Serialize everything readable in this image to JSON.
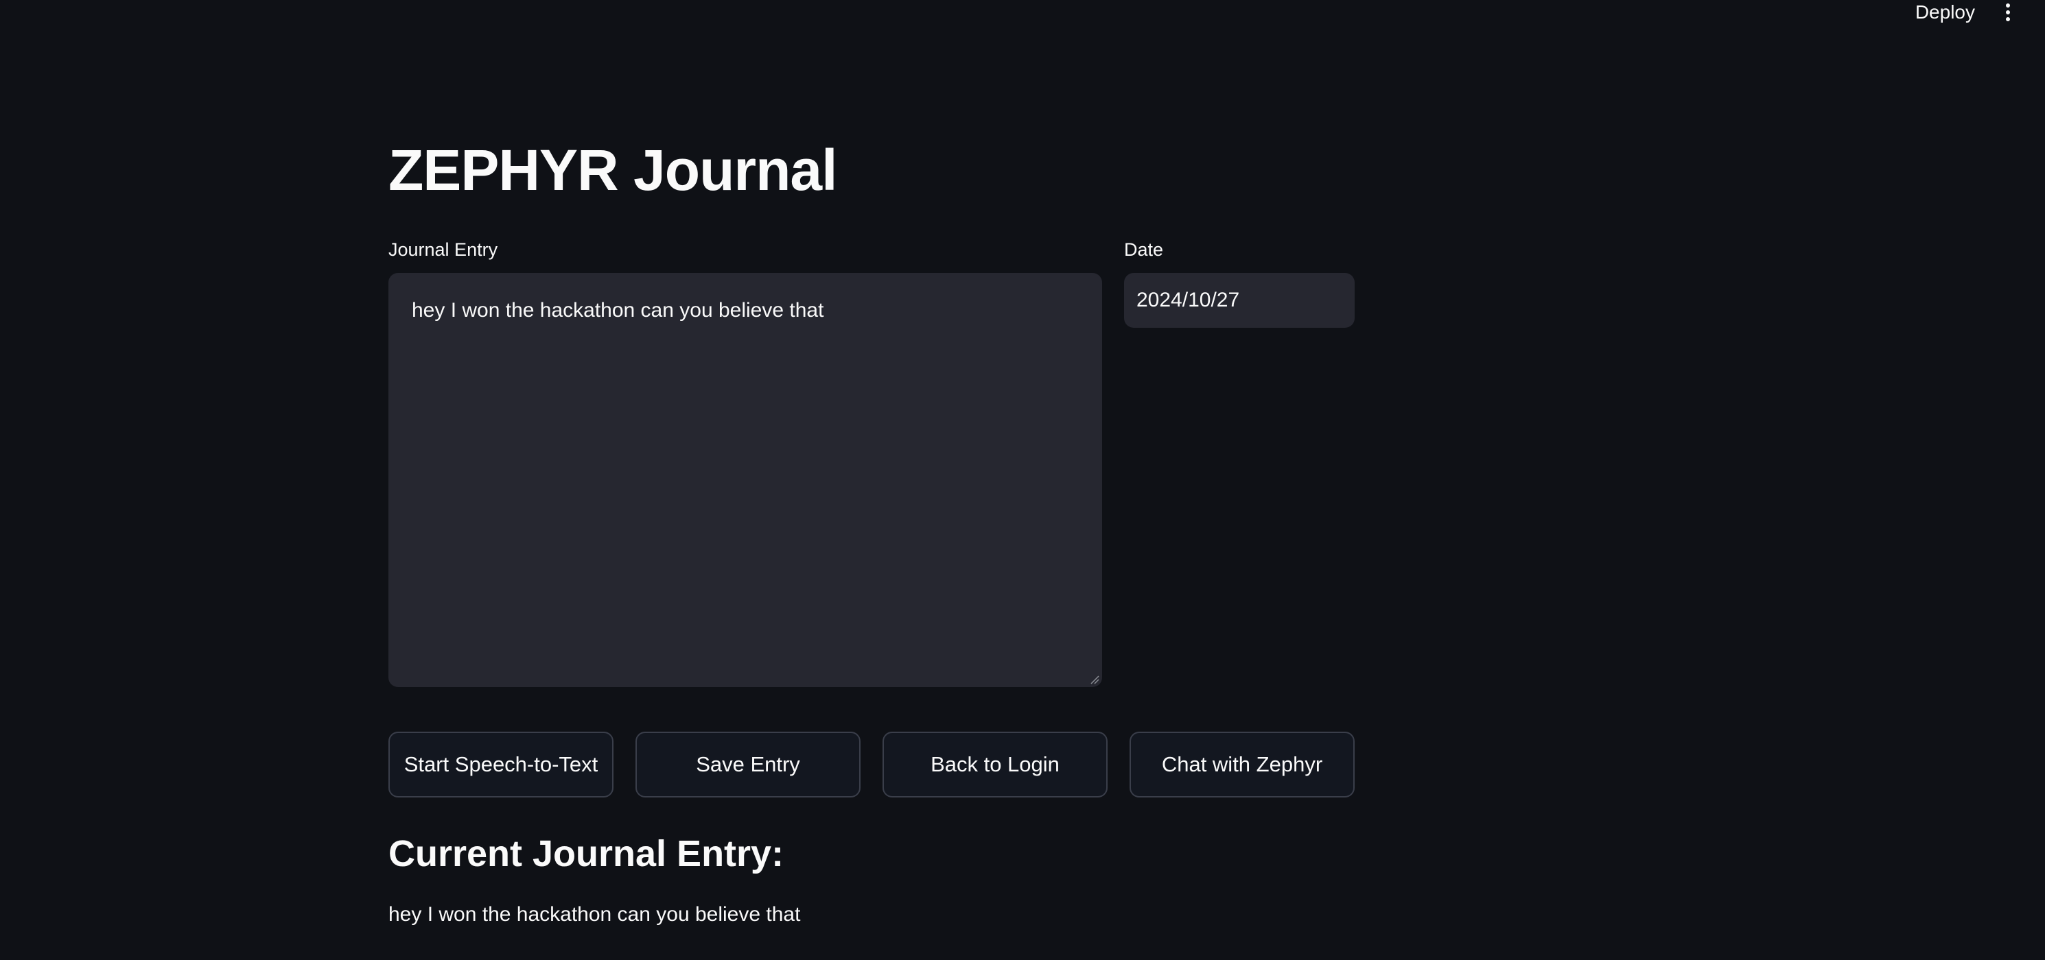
{
  "header": {
    "deploy_label": "Deploy",
    "menu_icon": "vertical-ellipsis-icon"
  },
  "page": {
    "title": "ZEPHYR Journal"
  },
  "form": {
    "journal_label": "Journal Entry",
    "journal_value": "hey I won the hackathon can you believe that",
    "date_label": "Date",
    "date_value": "2024/10/27"
  },
  "buttons": {
    "speech": "Start Speech-to-Text",
    "save": "Save Entry",
    "back": "Back to Login",
    "chat": "Chat with Zephyr"
  },
  "current_entry": {
    "heading": "Current Journal Entry:",
    "text": "hey I won the hackathon can you believe that"
  },
  "colors": {
    "background": "#0f1116",
    "input_bg": "#262730",
    "button_bg": "#131720",
    "button_border": "#3a3e4a",
    "text": "#fafafa"
  }
}
